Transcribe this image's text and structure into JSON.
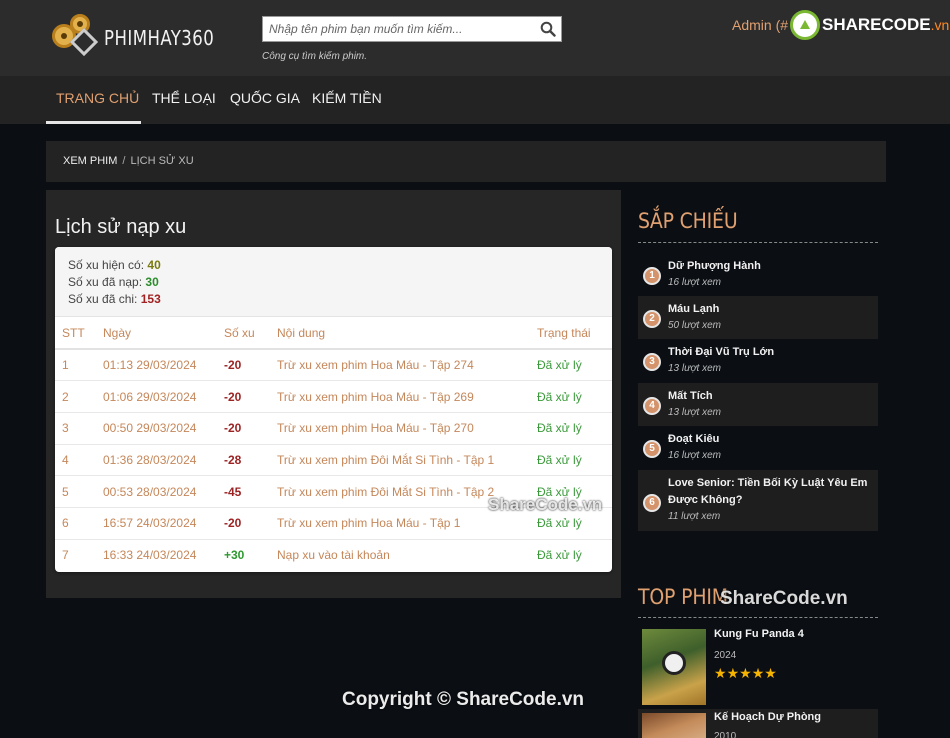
{
  "header": {
    "logo_text": "PHIMHAY360",
    "search": {
      "placeholder": "Nhập tên phim bạn muốn tìm kiếm...",
      "hint": "Công cụ tìm kiếm phim."
    },
    "admin": "Admin (#",
    "watermark_logo": {
      "main": "SHARECODE",
      "suffix": ".vn"
    }
  },
  "nav": {
    "items": [
      "TRANG CHỦ",
      "THỂ LOẠI",
      "QUỐC GIA",
      "KIẾM TIỀN"
    ]
  },
  "breadcrumb": {
    "home": "XEM PHIM",
    "separator": "/",
    "current": "LỊCH SỬ XU"
  },
  "main": {
    "title": "Lịch sử nạp xu",
    "stats": {
      "current_label": "Số xu hiện có:",
      "current_value": "40",
      "recharged_label": "Số xu đã nạp:",
      "recharged_value": "30",
      "spent_label": "Số xu đã chi:",
      "spent_value": "153"
    },
    "table": {
      "headers": [
        "STT",
        "Ngày",
        "Số xu",
        "Nội dung",
        "Trạng thái"
      ],
      "rows": [
        {
          "stt": "1",
          "date": "01:13 29/03/2024",
          "amount": "-20",
          "content": "Trừ xu xem phim Hoa Máu - Tập 274",
          "status": "Đã xử lý"
        },
        {
          "stt": "2",
          "date": "01:06 29/03/2024",
          "amount": "-20",
          "content": "Trừ xu xem phim Hoa Máu - Tập 269",
          "status": "Đã xử lý"
        },
        {
          "stt": "3",
          "date": "00:50 29/03/2024",
          "amount": "-20",
          "content": "Trừ xu xem phim Hoa Máu - Tập 270",
          "status": "Đã xử lý"
        },
        {
          "stt": "4",
          "date": "01:36 28/03/2024",
          "amount": "-28",
          "content": "Trừ xu xem phim Đôi Mắt Si Tình - Tập 1",
          "status": "Đã xử lý"
        },
        {
          "stt": "5",
          "date": "00:53 28/03/2024",
          "amount": "-45",
          "content": "Trừ xu xem phim Đôi Mắt Si Tình - Tập 2",
          "status": "Đã xử lý"
        },
        {
          "stt": "6",
          "date": "16:57 24/03/2024",
          "amount": "-20",
          "content": "Trừ xu xem phim Hoa Máu - Tập 1",
          "status": "Đã xử lý"
        },
        {
          "stt": "7",
          "date": "16:33 24/03/2024",
          "amount": "+30",
          "content": "Nạp xu vào tài khoản",
          "status": "Đã xử lý"
        }
      ]
    }
  },
  "sidebar": {
    "upcoming_title": "SẮP CHIẾU",
    "upcoming": [
      {
        "rank": "1",
        "title": "Dữ Phượng Hành",
        "views": "16 lượt xem"
      },
      {
        "rank": "2",
        "title": "Máu Lạnh",
        "views": "50 lượt xem"
      },
      {
        "rank": "3",
        "title": "Thời Đại Vũ Trụ Lớn",
        "views": "13 lượt xem"
      },
      {
        "rank": "4",
        "title": "Mất Tích",
        "views": "13 lượt xem"
      },
      {
        "rank": "5",
        "title": "Đoạt Kiêu",
        "views": "16 lượt xem"
      },
      {
        "rank": "6",
        "title": "Love Senior: Tiền Bối Kỳ Luật Yêu Em Được Không?",
        "views": "11 lượt xem"
      }
    ],
    "top_title": "TOP PHIM",
    "top": [
      {
        "title": "Kung Fu Panda 4",
        "year": "2024",
        "rating": 5
      },
      {
        "title": "Kế Hoạch Dự Phòng",
        "year": "2010"
      }
    ]
  },
  "watermarks": {
    "mid": "ShareCode.vn",
    "side": "ShareCode.vn",
    "copyright": "Copyright © ShareCode.vn"
  },
  "colors": {
    "accent": "#e0a070",
    "header_bg": "#2c2c2c",
    "nav_bg": "#232323",
    "page_bg": "#0b0f14",
    "negative": "#9c2323",
    "positive": "#2f9a2f"
  }
}
